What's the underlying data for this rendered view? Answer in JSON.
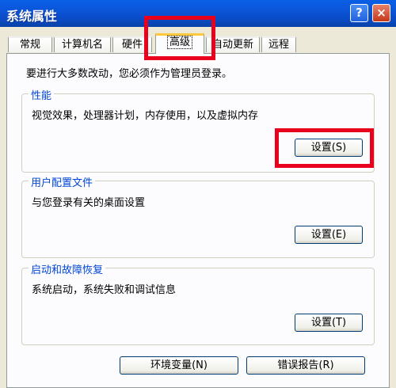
{
  "window": {
    "title": "系统属性",
    "help_glyph": "?",
    "close_glyph": "×"
  },
  "tabs": [
    {
      "label": "常规"
    },
    {
      "label": "计算机名"
    },
    {
      "label": "硬件"
    },
    {
      "label": "高级",
      "active": true
    },
    {
      "label": "自动更新"
    },
    {
      "label": "远程"
    }
  ],
  "main": {
    "intro": "要进行大多数改动，您必须作为管理员登录。",
    "performance": {
      "legend": "性能",
      "desc": "视觉效果，处理器计划，内存使用，以及虚拟内存",
      "button": "设置(S)"
    },
    "user_profiles": {
      "legend": "用户配置文件",
      "desc": "与您登录有关的桌面设置",
      "button": "设置(E)"
    },
    "startup_recovery": {
      "legend": "启动和故障恢复",
      "desc": "系统启动，系统失败和调试信息",
      "button": "设置(T)"
    },
    "env_button": "环境变量(N)",
    "error_report_button": "错误报告(R)"
  },
  "colors": {
    "highlight": "#e8001c",
    "titlebar": "#0a5fe6",
    "group_legend": "#0046d5"
  }
}
